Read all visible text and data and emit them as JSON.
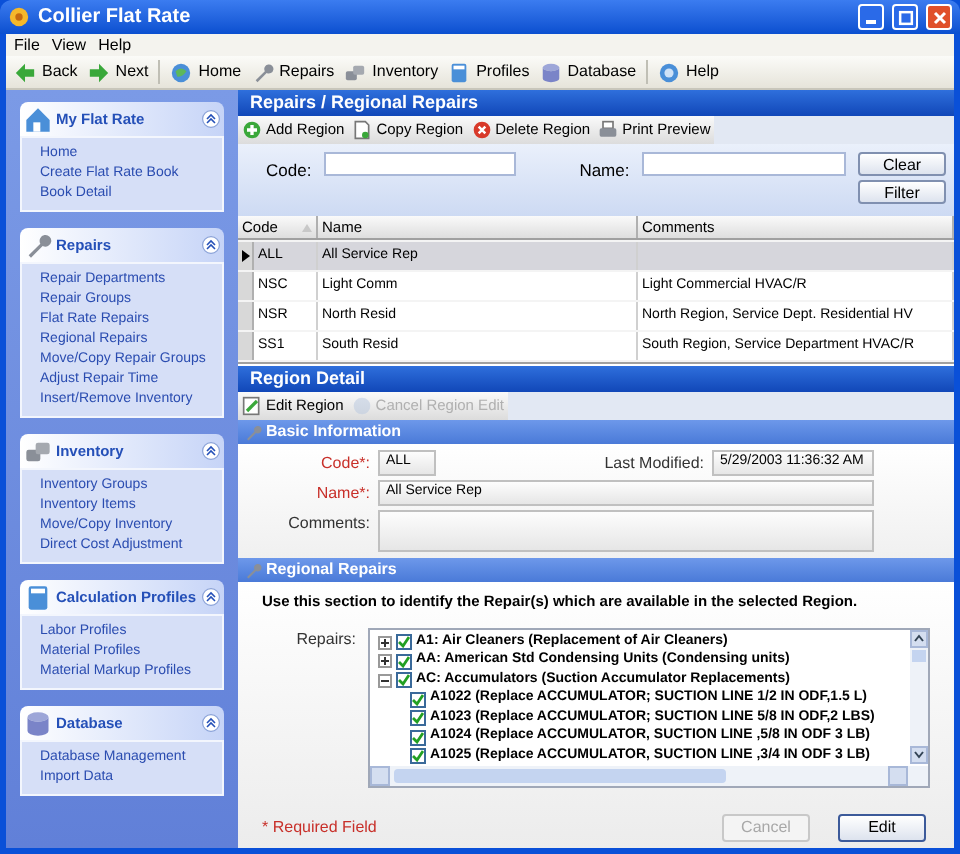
{
  "window": {
    "title": "Collier Flat Rate"
  },
  "menu": [
    "File",
    "View",
    "Help"
  ],
  "toolbar": [
    {
      "label": "Back",
      "kind": "back"
    },
    {
      "label": "Next",
      "kind": "next"
    },
    {
      "label": "Home",
      "kind": "home"
    },
    {
      "label": "Repairs",
      "kind": "wrench"
    },
    {
      "label": "Inventory",
      "kind": "inventory"
    },
    {
      "label": "Profiles",
      "kind": "profiles"
    },
    {
      "label": "Database",
      "kind": "database"
    },
    {
      "label": "Help",
      "kind": "help"
    }
  ],
  "sidebar": [
    {
      "title": "My Flat Rate",
      "kind": "house",
      "items": [
        "Home",
        "Create Flat Rate Book",
        "Book Detail"
      ]
    },
    {
      "title": "Repairs",
      "kind": "wrench",
      "items": [
        "Repair Departments",
        "Repair Groups",
        "Flat Rate Repairs",
        "Regional Repairs",
        "Move/Copy Repair Groups",
        "Adjust Repair Time",
        "Insert/Remove Inventory"
      ]
    },
    {
      "title": "Inventory",
      "kind": "inventory",
      "items": [
        "Inventory Groups",
        "Inventory Items",
        "Move/Copy Inventory",
        "Direct Cost Adjustment"
      ]
    },
    {
      "title": "Calculation Profiles",
      "kind": "calculator",
      "items": [
        "Labor Profiles",
        "Material Profiles",
        "Material Markup Profiles"
      ]
    },
    {
      "title": "Database",
      "kind": "database",
      "items": [
        "Database Management",
        "Import Data"
      ]
    }
  ],
  "main": {
    "title": "Repairs / Regional Repairs",
    "actions": [
      {
        "label": "Add Region",
        "kind": "add"
      },
      {
        "label": "Copy Region",
        "kind": "copy"
      },
      {
        "label": "Delete Region",
        "kind": "delete"
      },
      {
        "label": "Print Preview",
        "kind": "print"
      }
    ],
    "filter": {
      "code_label": "Code:",
      "name_label": "Name:",
      "buttons": [
        "Clear",
        "Filter"
      ]
    },
    "table": {
      "columns": [
        "Code",
        "Name",
        "Comments"
      ],
      "rows": [
        {
          "cells": [
            "ALL",
            "All Service Rep",
            ""
          ],
          "selected": true
        },
        {
          "cells": [
            "NSC",
            "Light Comm",
            "Light Commercial HVAC/R"
          ],
          "selected": false
        },
        {
          "cells": [
            "NSR",
            "North Resid",
            "North Region, Service Dept. Residential HV"
          ],
          "selected": false
        },
        {
          "cells": [
            "SS1",
            "South Resid",
            "South Region, Service Department HVAC/R"
          ],
          "selected": false
        }
      ]
    },
    "detail": {
      "title": "Region Detail",
      "actions": [
        {
          "label": "Edit Region",
          "kind": "edit",
          "disabled": false
        },
        {
          "label": "Cancel Region Edit",
          "kind": "cancel",
          "disabled": true
        }
      ],
      "basic": {
        "title": "Basic Information",
        "code": {
          "label": "Code*:",
          "value": "ALL"
        },
        "last_modified": {
          "label": "Last Modified:",
          "value": "5/29/2003 11:36:32 AM"
        },
        "name": {
          "label": "Name*:",
          "value": "All Service Rep"
        },
        "comments": {
          "label": "Comments:"
        }
      },
      "regional": {
        "title": "Regional Repairs",
        "instructions": "Use this section to identify the Repair(s) which are available in the selected Region.",
        "repairs_label": "Repairs:",
        "tree": [
          {
            "label": "A1:  Air Cleaners (Replacement of Air Cleaners)",
            "checked": true,
            "expanded": false
          },
          {
            "label": "AA:  American Std Condensing Units (Condensing units)",
            "checked": true,
            "expanded": false
          },
          {
            "label": "AC:  Accumulators (Suction Accumulator Replacements)",
            "checked": true,
            "expanded": true,
            "children": [
              {
                "label": "A1022 (Replace ACCUMULATOR; SUCTION LINE 1/2 IN ODF,1.5 L)",
                "checked": true
              },
              {
                "label": "A1023 (Replace ACCUMULATOR; SUCTION LINE 5/8 IN ODF,2 LBS)",
                "checked": true
              },
              {
                "label": "A1024 (Replace ACCUMULATOR, SUCTION LINE ,5/8 IN ODF 3 LB)",
                "checked": true
              },
              {
                "label": "A1025 (Replace ACCUMULATOR, SUCTION LINE ,3/4 IN ODF 3 LB)",
                "checked": true
              }
            ]
          }
        ]
      },
      "required_note": "* Required Field",
      "buttons": [
        {
          "label": "Cancel",
          "disabled": true
        },
        {
          "label": "Edit",
          "disabled": false
        }
      ]
    }
  }
}
